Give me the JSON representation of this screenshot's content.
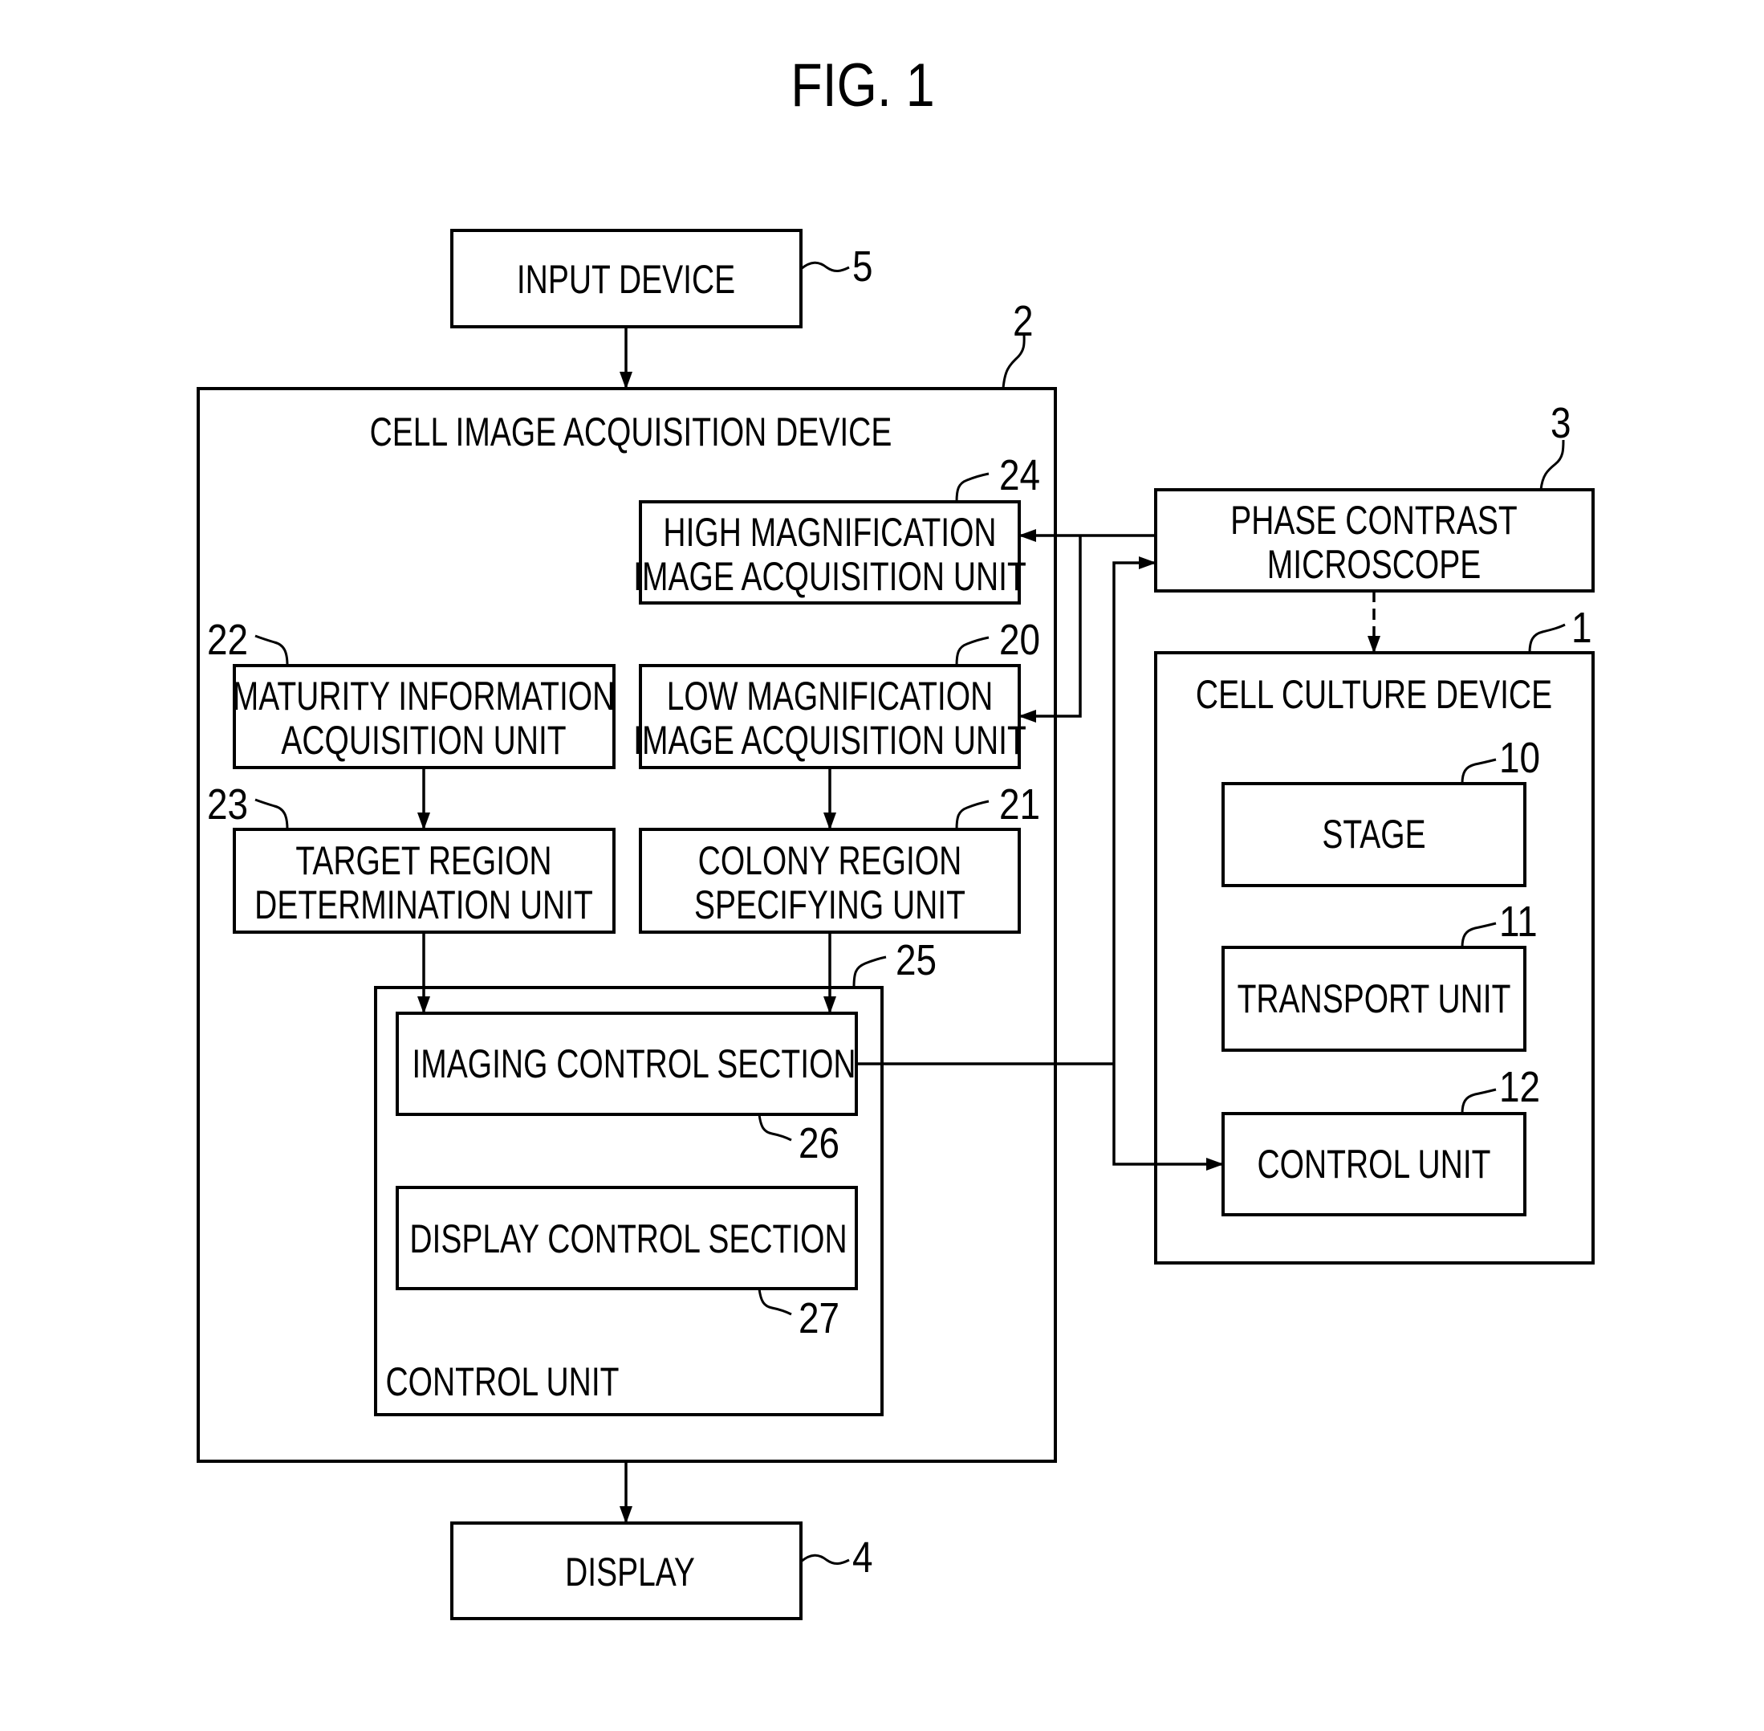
{
  "figure": {
    "title": "FIG. 1"
  },
  "blocks": {
    "input_device": {
      "label_lines": [
        "INPUT DEVICE"
      ],
      "ref": "5"
    },
    "cell_image_acquisition_device": {
      "label_lines": [
        "CELL IMAGE ACQUISITION DEVICE"
      ],
      "ref": "2"
    },
    "high_magnification_unit": {
      "label_lines": [
        "HIGH MAGNIFICATION",
        "IMAGE ACQUISITION UNIT"
      ],
      "ref": "24"
    },
    "maturity_information_unit": {
      "label_lines": [
        "MATURITY INFORMATION",
        "ACQUISITION UNIT"
      ],
      "ref": "22"
    },
    "low_magnification_unit": {
      "label_lines": [
        "LOW MAGNIFICATION",
        "IMAGE ACQUISITION UNIT"
      ],
      "ref": "20"
    },
    "target_region_unit": {
      "label_lines": [
        "TARGET REGION",
        "DETERMINATION UNIT"
      ],
      "ref": "23"
    },
    "colony_region_unit": {
      "label_lines": [
        "COLONY REGION",
        "SPECIFYING UNIT"
      ],
      "ref": "21"
    },
    "control_unit_25": {
      "label_lines": [
        "CONTROL UNIT"
      ],
      "ref": "25"
    },
    "imaging_control_section": {
      "label_lines": [
        "IMAGING CONTROL SECTION"
      ],
      "ref": "26"
    },
    "display_control_section": {
      "label_lines": [
        "DISPLAY CONTROL SECTION"
      ],
      "ref": "27"
    },
    "display": {
      "label_lines": [
        "DISPLAY"
      ],
      "ref": "4"
    },
    "phase_contrast_microscope": {
      "label_lines": [
        "PHASE CONTRAST",
        "MICROSCOPE"
      ],
      "ref": "3"
    },
    "cell_culture_device": {
      "label_lines": [
        "CELL CULTURE DEVICE"
      ],
      "ref": "1"
    },
    "stage": {
      "label_lines": [
        "STAGE"
      ],
      "ref": "10"
    },
    "transport_unit": {
      "label_lines": [
        "TRANSPORT UNIT"
      ],
      "ref": "11"
    },
    "control_unit_12": {
      "label_lines": [
        "CONTROL UNIT"
      ],
      "ref": "12"
    }
  },
  "connections": [
    {
      "from": "input_device",
      "to": "cell_image_acquisition_device",
      "style": "solid"
    },
    {
      "from": "phase_contrast_microscope",
      "to": "high_magnification_unit",
      "style": "solid"
    },
    {
      "from": "phase_contrast_microscope",
      "to": "low_magnification_unit",
      "style": "solid"
    },
    {
      "from": "maturity_information_unit",
      "to": "target_region_unit",
      "style": "solid"
    },
    {
      "from": "low_magnification_unit",
      "to": "colony_region_unit",
      "style": "solid"
    },
    {
      "from": "target_region_unit",
      "to": "imaging_control_section",
      "style": "solid"
    },
    {
      "from": "colony_region_unit",
      "to": "imaging_control_section",
      "style": "solid"
    },
    {
      "from": "imaging_control_section",
      "to": "phase_contrast_microscope",
      "style": "solid"
    },
    {
      "from": "imaging_control_section",
      "to": "control_unit_12",
      "style": "solid"
    },
    {
      "from": "phase_contrast_microscope",
      "to": "cell_culture_device",
      "style": "dashed"
    },
    {
      "from": "cell_image_acquisition_device",
      "to": "display",
      "style": "solid"
    }
  ]
}
